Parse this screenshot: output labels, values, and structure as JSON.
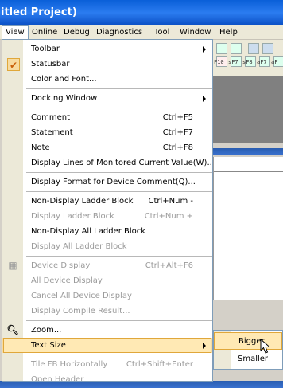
{
  "window": {
    "title": "itled Project)"
  },
  "menubar": {
    "items": [
      {
        "label": "View"
      },
      {
        "label": "Online"
      },
      {
        "label": "Debug"
      },
      {
        "label": "Diagnostics"
      },
      {
        "label": "Tool"
      },
      {
        "label": "Window"
      },
      {
        "label": "Help"
      }
    ]
  },
  "toolbar": {
    "ladder_symbols": [
      "F10",
      "sF7",
      "sF8",
      "aF7",
      "aF"
    ]
  },
  "view_menu": {
    "items": [
      {
        "label": "Toolbar",
        "submenu": true
      },
      {
        "label": "Statusbar",
        "checked": true
      },
      {
        "label": "Color and Font..."
      },
      {
        "label": "Docking Window",
        "submenu": true
      },
      {
        "label": "Comment",
        "shortcut": "Ctrl+F5"
      },
      {
        "label": "Statement",
        "shortcut": "Ctrl+F7"
      },
      {
        "label": "Note",
        "shortcut": "Ctrl+F8"
      },
      {
        "label": "Display Lines of Monitored Current Value(W)..."
      },
      {
        "label": "Display Format for Device Comment(Q)..."
      },
      {
        "label": "Non-Display Ladder Block",
        "shortcut": "Ctrl+Num -"
      },
      {
        "label": "Display Ladder Block",
        "shortcut": "Ctrl+Num +",
        "disabled": true
      },
      {
        "label": "Non-Display All Ladder Block"
      },
      {
        "label": "Display All Ladder Block",
        "disabled": true
      },
      {
        "label": "Device Display",
        "shortcut": "Ctrl+Alt+F6",
        "disabled": true
      },
      {
        "label": "All Device Display",
        "disabled": true
      },
      {
        "label": "Cancel All Device Display",
        "disabled": true
      },
      {
        "label": "Display Compile Result...",
        "disabled": true
      },
      {
        "label": "Zoom..."
      },
      {
        "label": "Text Size",
        "submenu": true,
        "highlighted": true
      },
      {
        "label": "Tile FB Horizontally",
        "shortcut": "Ctrl+Shift+Enter",
        "disabled": true
      },
      {
        "label": "Open Header",
        "disabled": true
      }
    ]
  },
  "text_size_submenu": {
    "items": [
      {
        "label": "Bigger",
        "highlighted": true
      },
      {
        "label": "Smaller"
      }
    ]
  },
  "colors": {
    "highlight": "#ffe9b4",
    "highlight_border": "#e0a73a",
    "title_bar": "#0a5fd8"
  }
}
